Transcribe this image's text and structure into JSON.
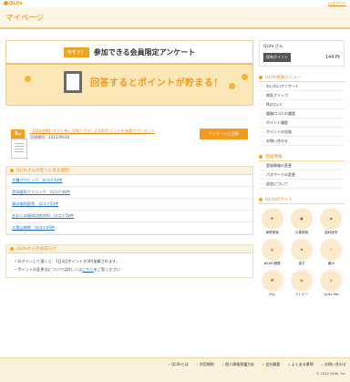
{
  "header": {
    "logo": "QLife",
    "logout": "ログアウト",
    "title": "マイページ"
  },
  "banner": {
    "pill": "今すぐ！",
    "title": "参加できる会員限定アンケート",
    "subtitle": "回答するとポイントが貯まる！"
  },
  "offer": {
    "points": "5",
    "unit": "pt",
    "title": "【100名様】ギフト券に交換できる！2,000ポイントを抽選でプレゼント",
    "deadline": "回答締切：2015/09/30",
    "button": "アンケートに回答"
  },
  "clinics": {
    "heading": "QLifeさんの近くにある病院",
    "items": [
      "大橋クリニック　口コミ43件",
      "宮岡歯科クリニック　口コミ44件",
      "東口歯科医院　口コミ53件",
      "おおくぼ歯科口腔外科　口コミ59件",
      "久我山病院　口コミ45件"
    ]
  },
  "notice": {
    "heading": "QLifeからのお知らせ",
    "items": [
      "・ログインして頂くと、1日1回ポイントが3P(加算されます。",
      "・ポイントの変更点については詳しくは"
    ],
    "link": "こちら",
    "tail": "をご覧ください"
  },
  "account": {
    "name": "QLife さん",
    "points_label": "保有ポイント",
    "points": "144",
    "unit": "Pt"
  },
  "member_menu": {
    "heading": "QLife会員メニュー",
    "items": [
      "わいわいアンケート",
      "病気クリップ",
      "My口コミ",
      "優勝口コミの履歴",
      "ポイント履歴",
      "ポイントの交換",
      "お問い合わせ"
    ]
  },
  "register": {
    "heading": "登録情報",
    "items": [
      "登録情報の変更",
      "パスワードの変更",
      "退会について"
    ]
  },
  "sites": {
    "heading": "QLifeのサイト",
    "items": [
      {
        "icon": "hospital-icon",
        "label": "病院検索"
      },
      {
        "icon": "medicine-icon",
        "label": "お薬検索"
      },
      {
        "icon": "dental-icon",
        "label": "歯科医学"
      },
      {
        "icon": "news-icon",
        "label": "NEWS健康"
      },
      {
        "icon": "kampo-icon",
        "label": "漢方"
      },
      {
        "icon": "pain-icon",
        "label": "痛み"
      },
      {
        "icon": "cancer-icon",
        "label": "がん"
      },
      {
        "icon": "atopy-icon",
        "label": "アトピー"
      },
      {
        "icon": "pet-icon",
        "label": "QLife Pet"
      }
    ]
  },
  "footer": {
    "links": [
      "QLifeとは",
      "利用規約",
      "個人情報保護方針",
      "会社概要",
      "よくある質問",
      "お問い合わせ"
    ],
    "copyright": "© 2015 QLife, Inc."
  }
}
